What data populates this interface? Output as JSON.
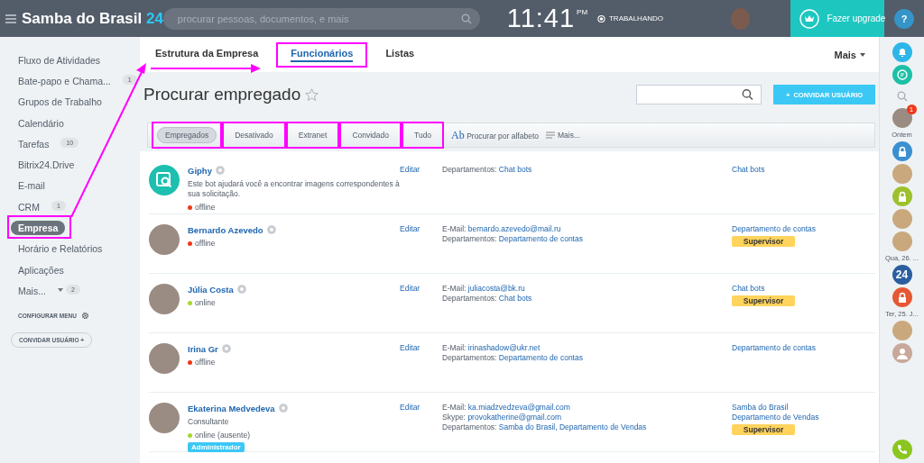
{
  "header": {
    "logo": "Samba do Brasil",
    "logo_suffix": "24",
    "search": {
      "placeholder": "procurar pessoas, documentos, e mais"
    },
    "time": "11:41",
    "ampm": "PM",
    "work_status": "TRABALHANDO",
    "upgrade": "Fazer upgrade",
    "help": "?"
  },
  "sidebar": {
    "items": [
      {
        "label": "Fluxo de Atividades",
        "selected": false,
        "annotated": false
      },
      {
        "label": "Bate-papo e Chama...",
        "counter": "1",
        "selected": false,
        "annotated": false
      },
      {
        "label": "Grupos de Trabalho",
        "selected": false,
        "annotated": false
      },
      {
        "label": "Calendário",
        "selected": false,
        "annotated": false
      },
      {
        "label": "Tarefas",
        "counter": "10",
        "selected": false,
        "annotated": false
      },
      {
        "label": "Bitrix24.Drive",
        "selected": false,
        "annotated": false
      },
      {
        "label": "E-mail",
        "selected": false,
        "annotated": false
      },
      {
        "label": "CRM",
        "counter": "1",
        "selected": false,
        "annotated": false
      },
      {
        "label": "Empresa",
        "selected": true,
        "annotated": true
      },
      {
        "label": "Horário e Relatórios",
        "selected": false,
        "annotated": false
      },
      {
        "label": "Aplicações",
        "selected": false,
        "annotated": false
      },
      {
        "label": "Mais...",
        "counter": "2",
        "dropdown": true,
        "selected": false,
        "annotated": false
      }
    ],
    "configure": "CONFIGURAR MENU",
    "invite": "CONVIDAR USUÁRIO",
    "invite_icon": "+"
  },
  "tabs": [
    {
      "label": "Estrutura da Empresa",
      "selected": false,
      "annotated": false
    },
    {
      "label": "Funcionários",
      "selected": true,
      "annotated": true
    },
    {
      "label": "Listas",
      "selected": false,
      "annotated": false
    }
  ],
  "tabs_more": "Mais",
  "page_title": "Procurar empregado",
  "invite_button": "CONVIDAR USUÁRIO",
  "invite_icon": "+",
  "filters": [
    {
      "label": "Empregados",
      "selected": true,
      "annotated": true
    },
    {
      "label": "Desativado",
      "selected": false,
      "annotated": true
    },
    {
      "label": "Extranet",
      "selected": false,
      "annotated": true
    },
    {
      "label": "Convidado",
      "selected": false,
      "annotated": true
    },
    {
      "label": "Tudo",
      "selected": false,
      "annotated": true
    }
  ],
  "alphabet": {
    "icon_text": "Ab",
    "label": "Procurar por alfabeto"
  },
  "filters_more": "Mais...",
  "employees": [
    {
      "name": "Giphy",
      "kind": "bot",
      "description": "Este bot ajudará você a encontrar imagens correspondentes à sua solicitação.",
      "presence": "offline",
      "online": false,
      "edit": "Editar",
      "fields": [
        {
          "label": "Departamentos:",
          "value": "Chat bots"
        }
      ],
      "departments": [
        "Chat bots"
      ]
    },
    {
      "name": "Bernardo Azevedo",
      "kind": "person",
      "presence": "offline",
      "online": false,
      "edit": "Editar",
      "fields": [
        {
          "label": "E-Mail:",
          "value": "bernardo.azevedo@mail.ru"
        },
        {
          "label": "Departamentos:",
          "value": "Departamento de contas"
        }
      ],
      "departments": [
        "Departamento de contas"
      ],
      "badge": "Supervisor"
    },
    {
      "name": "Júlia Costa",
      "kind": "person",
      "presence": "online",
      "online": true,
      "edit": "Editar",
      "fields": [
        {
          "label": "E-Mail:",
          "value": "juliacosta@bk.ru"
        },
        {
          "label": "Departamentos:",
          "value": "Chat bots"
        }
      ],
      "departments": [
        "Chat bots"
      ],
      "badge": "Supervisor"
    },
    {
      "name": "Irina Gr",
      "kind": "person",
      "presence": "offline",
      "online": false,
      "edit": "Editar",
      "fields": [
        {
          "label": "E-Mail:",
          "value": "irinashadow@ukr.net"
        },
        {
          "label": "Departamentos:",
          "value": "Departamento de contas"
        }
      ],
      "departments": [
        "Departamento de contas"
      ]
    },
    {
      "name": "Ekaterina Medvedeva",
      "kind": "person",
      "role": "Consultante",
      "presence": "online (ausente)",
      "online": true,
      "edit": "Editar",
      "fields": [
        {
          "label": "E-Mail:",
          "value": "ka.miadzvedzeva@gmail.com"
        },
        {
          "label": "Skype:",
          "value": "provokatherine@gmail.com"
        },
        {
          "label": "Departamentos:",
          "value": "Samba do Brasil, Departamento de Vendas"
        }
      ],
      "departments": [
        "Samba do Brasil",
        "Departamento de Vendas"
      ],
      "badge": "Supervisor",
      "admin": "Administrador"
    }
  ],
  "right_bar": [
    {
      "kind": "bell"
    },
    {
      "kind": "chat"
    },
    {
      "kind": "search"
    },
    {
      "kind": "avatar",
      "counter": "1"
    },
    {
      "kind": "caption",
      "text": "Ontem"
    },
    {
      "kind": "lock",
      "color": "#3a8fd1"
    },
    {
      "kind": "picture"
    },
    {
      "kind": "lock",
      "color": "#9dc12d"
    },
    {
      "kind": "picture"
    },
    {
      "kind": "picture"
    },
    {
      "kind": "caption",
      "text": "Qua, 26. ..."
    },
    {
      "kind": "logo",
      "text": "24"
    },
    {
      "kind": "lock",
      "color": "#e65835"
    },
    {
      "kind": "caption",
      "text": "Ter, 25. J..."
    },
    {
      "kind": "picture"
    },
    {
      "kind": "user"
    },
    {
      "kind": "phone"
    }
  ]
}
